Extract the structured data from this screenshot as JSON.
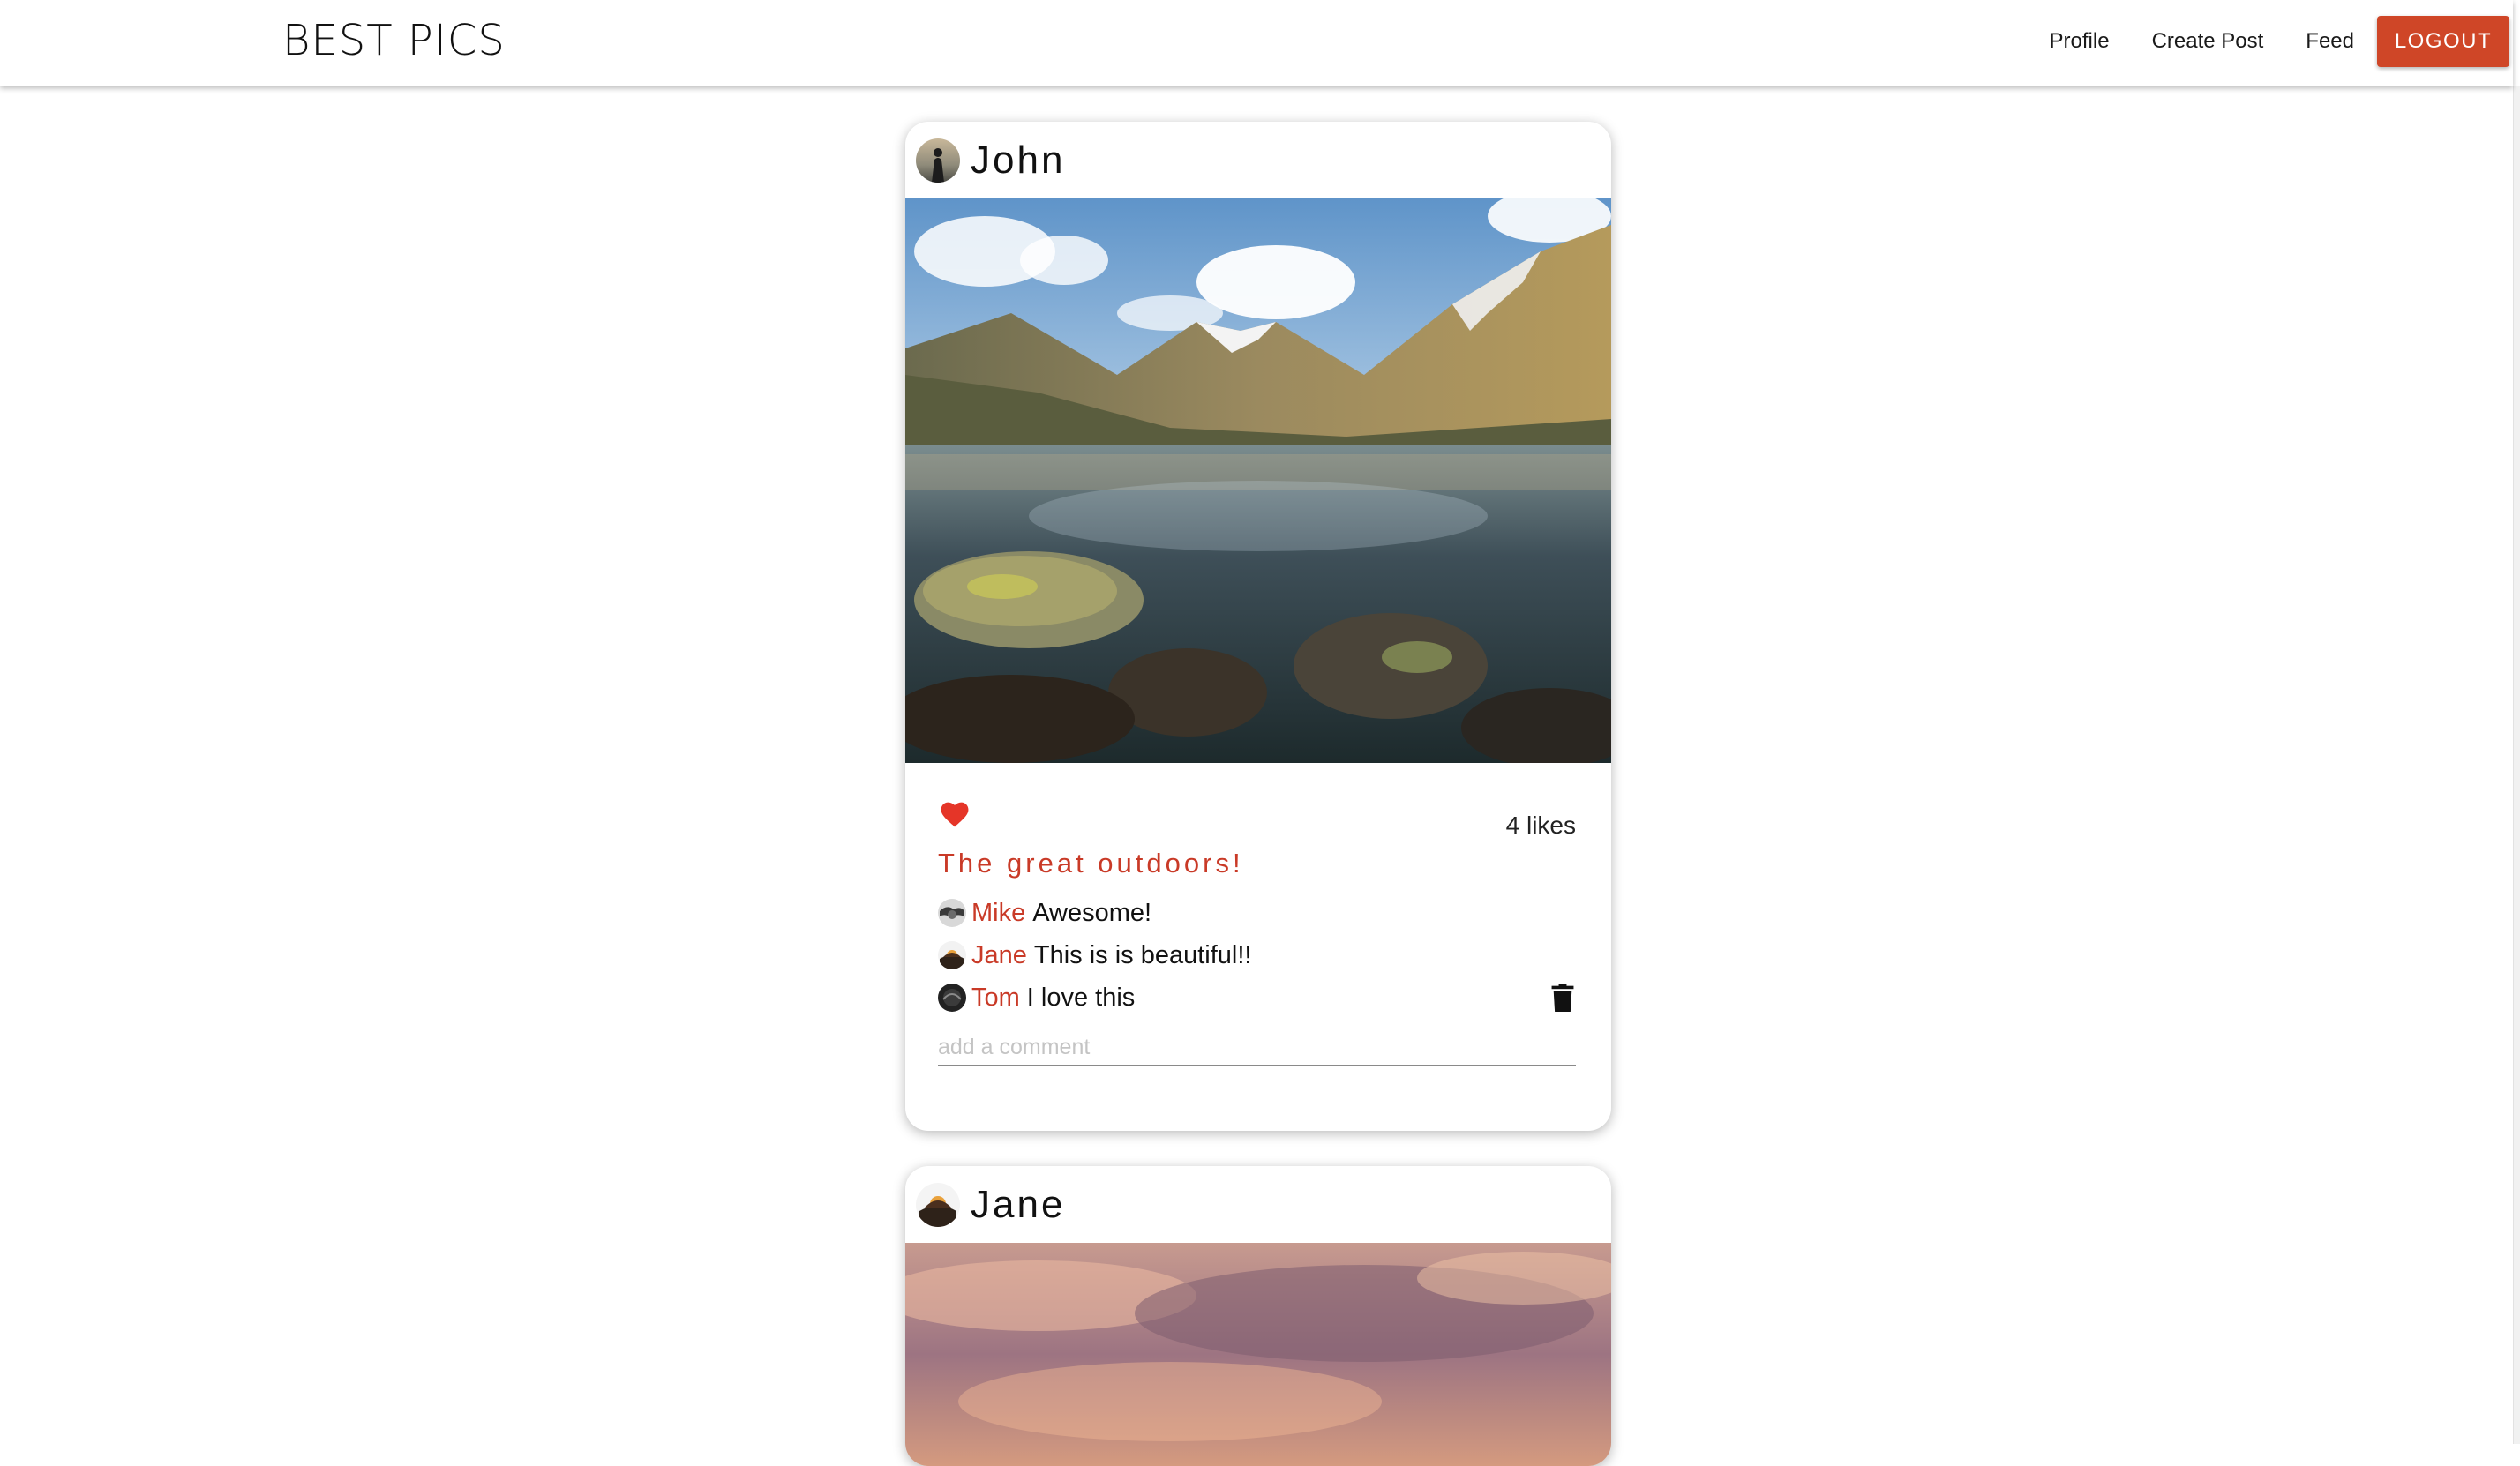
{
  "navbar": {
    "brand": "BEST PICS",
    "links": [
      "Profile",
      "Create Post",
      "Feed"
    ],
    "logout_label": "LOGOUT",
    "logout_color": "#cf4627"
  },
  "posts": [
    {
      "author": "John",
      "likes": "4 likes",
      "liked": true,
      "caption": "The great outdoors!",
      "comments": [
        {
          "user": "Mike",
          "text": "Awesome!"
        },
        {
          "user": "Jane",
          "text": "This is is beautiful!!"
        },
        {
          "user": "Tom",
          "text": "I love this",
          "deletable": true
        }
      ],
      "comment_placeholder": "add a comment"
    },
    {
      "author": "Jane"
    }
  ],
  "colors": {
    "accent": "#c93a27",
    "heart": "#e53528"
  },
  "icons": [
    "heart-icon",
    "trash-icon"
  ]
}
